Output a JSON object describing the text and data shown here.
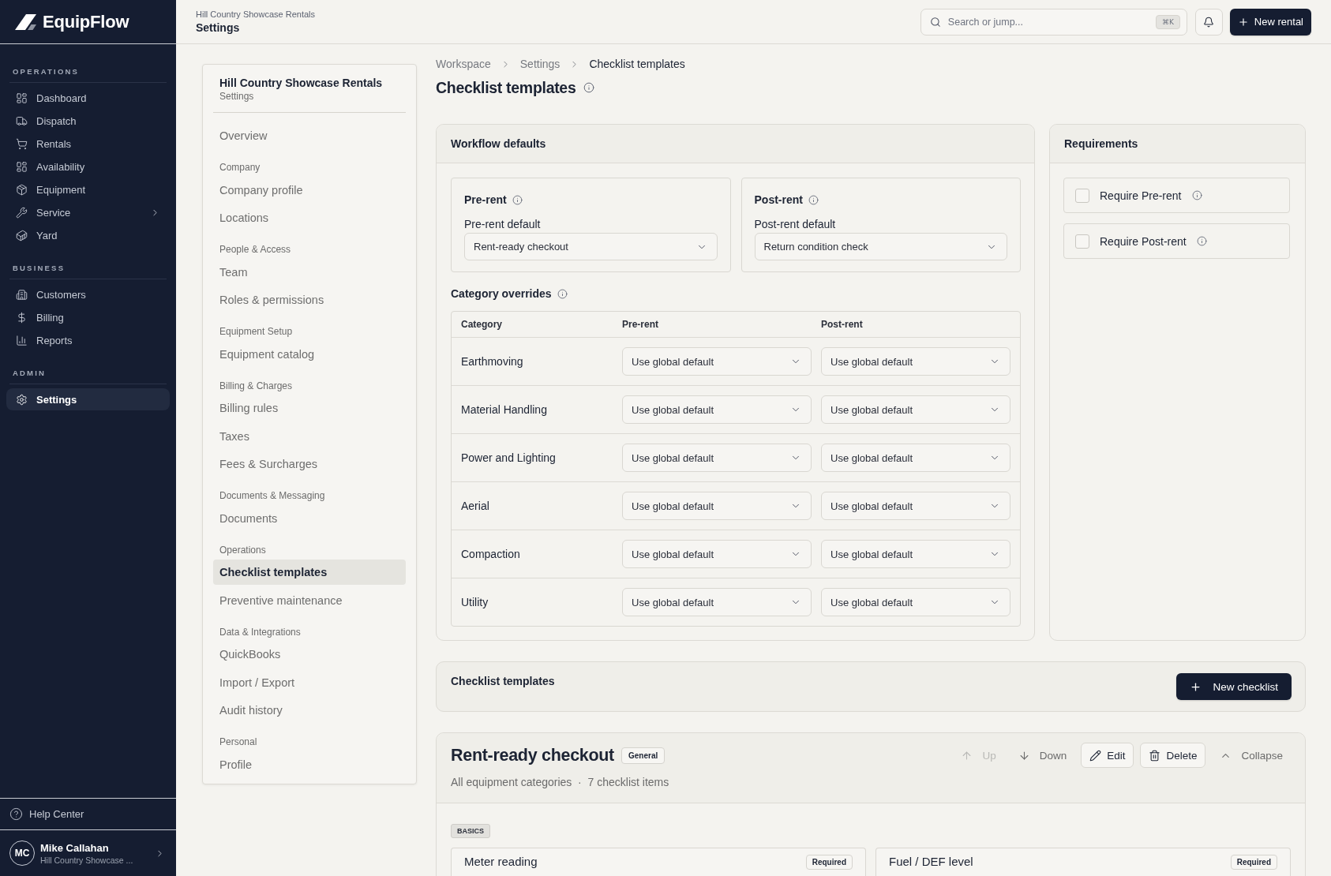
{
  "sidebar": {
    "logo": "EquipFlow",
    "sections": [
      {
        "title": "OPERATIONS",
        "items": [
          {
            "label": "Dashboard",
            "selected": false,
            "expandable": false
          },
          {
            "label": "Dispatch",
            "selected": false,
            "expandable": false
          },
          {
            "label": "Rentals",
            "selected": false,
            "expandable": false
          },
          {
            "label": "Availability",
            "selected": false,
            "expandable": false
          },
          {
            "label": "Equipment",
            "selected": false,
            "expandable": false
          },
          {
            "label": "Service",
            "selected": false,
            "expandable": true
          },
          {
            "label": "Yard",
            "selected": false,
            "expandable": false
          }
        ]
      },
      {
        "title": "BUSINESS",
        "items": [
          {
            "label": "Customers",
            "selected": false,
            "expandable": false
          },
          {
            "label": "Billing",
            "selected": false,
            "expandable": false
          },
          {
            "label": "Reports",
            "selected": false,
            "expandable": false
          }
        ]
      },
      {
        "title": "ADMIN",
        "items": [
          {
            "label": "Settings",
            "selected": true,
            "expandable": false
          }
        ]
      }
    ],
    "help": "Help Center",
    "user": {
      "initials": "MC",
      "name": "Mike Callahan",
      "org": "Hill Country Showcase ..."
    }
  },
  "header": {
    "org": "Hill Country Showcase Rentals",
    "title": "Settings",
    "search": {
      "placeholder": "Search or jump...",
      "shortcut": "⌘K"
    },
    "new_button": "New rental"
  },
  "settings_nav": {
    "title": "Hill Country Showcase Rentals",
    "subtitle": "Settings",
    "groups": [
      {
        "items": [
          {
            "label": "Overview",
            "selected": false
          }
        ]
      },
      {
        "heading": "Company",
        "items": [
          {
            "label": "Company profile",
            "selected": false
          },
          {
            "label": "Locations",
            "selected": false
          }
        ]
      },
      {
        "heading": "People & Access",
        "items": [
          {
            "label": "Team",
            "selected": false
          },
          {
            "label": "Roles & permissions",
            "selected": false
          }
        ]
      },
      {
        "heading": "Equipment Setup",
        "items": [
          {
            "label": "Equipment catalog",
            "selected": false
          }
        ]
      },
      {
        "heading": "Billing & Charges",
        "items": [
          {
            "label": "Billing rules",
            "selected": false
          },
          {
            "label": "Taxes",
            "selected": false
          },
          {
            "label": "Fees & Surcharges",
            "selected": false
          }
        ]
      },
      {
        "heading": "Documents & Messaging",
        "items": [
          {
            "label": "Documents",
            "selected": false
          }
        ]
      },
      {
        "heading": "Operations",
        "items": [
          {
            "label": "Checklist templates",
            "selected": true
          },
          {
            "label": "Preventive maintenance",
            "selected": false
          }
        ]
      },
      {
        "heading": "Data & Integrations",
        "items": [
          {
            "label": "QuickBooks",
            "selected": false
          },
          {
            "label": "Import / Export",
            "selected": false
          },
          {
            "label": "Audit history",
            "selected": false
          }
        ]
      },
      {
        "heading": "Personal",
        "items": [
          {
            "label": "Profile",
            "selected": false
          }
        ]
      }
    ]
  },
  "breadcrumb": [
    "Workspace",
    "Settings",
    "Checklist templates"
  ],
  "page_title": "Checklist templates",
  "workflow_defaults": {
    "title": "Workflow defaults",
    "defaults": [
      {
        "title": "Pre-rent",
        "label": "Pre-rent default",
        "value": "Rent-ready checkout"
      },
      {
        "title": "Post-rent",
        "label": "Post-rent default",
        "value": "Return condition check"
      }
    ],
    "overrides": {
      "title": "Category overrides",
      "columns": [
        "Category",
        "Pre-rent",
        "Post-rent"
      ],
      "rows": [
        {
          "category": "Earthmoving",
          "pre_rent": "Use global default",
          "post_rent": "Use global default"
        },
        {
          "category": "Material Handling",
          "pre_rent": "Use global default",
          "post_rent": "Use global default"
        },
        {
          "category": "Power and Lighting",
          "pre_rent": "Use global default",
          "post_rent": "Use global default"
        },
        {
          "category": "Aerial",
          "pre_rent": "Use global default",
          "post_rent": "Use global default"
        },
        {
          "category": "Compaction",
          "pre_rent": "Use global default",
          "post_rent": "Use global default"
        },
        {
          "category": "Utility",
          "pre_rent": "Use global default",
          "post_rent": "Use global default"
        }
      ]
    }
  },
  "requirements": {
    "title": "Requirements",
    "items": [
      {
        "label": "Require Pre-rent",
        "checked": false
      },
      {
        "label": "Require Post-rent",
        "checked": false
      }
    ]
  },
  "templates": {
    "title": "Checklist templates",
    "new_button": "New checklist",
    "items": [
      {
        "title": "Rent-ready checkout",
        "tag": "General",
        "meta": "All equipment categories  ·  7 checklist items",
        "actions": [
          {
            "label": "Up",
            "kind": "plain",
            "disabled": true
          },
          {
            "label": "Down",
            "kind": "plain",
            "disabled": false
          },
          {
            "label": "Edit",
            "kind": "outlined",
            "disabled": false
          },
          {
            "label": "Delete",
            "kind": "outlined",
            "disabled": false
          },
          {
            "label": "Collapse",
            "kind": "plain",
            "disabled": false
          }
        ],
        "groups": [
          {
            "title": "BASICS",
            "items": [
              {
                "title": "Meter reading",
                "badge": "Required"
              },
              {
                "title": "Fuel / DEF level",
                "badge": "Required"
              }
            ]
          }
        ]
      }
    ]
  }
}
